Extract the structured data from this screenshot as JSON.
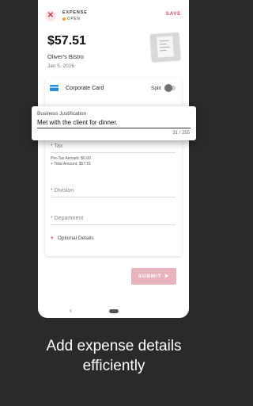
{
  "header": {
    "title": "EXPENSE",
    "status": "OPEN",
    "save_label": "SAVE",
    "close_icon": "close-icon",
    "status_dot_color": "#f2a12b"
  },
  "expense": {
    "amount": "$57.51",
    "merchant": "Oliver's Bistro",
    "date": "Jan 5, 2026"
  },
  "payment": {
    "method": "Corporate Card",
    "split_label": "Split",
    "split_enabled": false
  },
  "justification": {
    "label": "Business Justification",
    "value": "Met with the client for dinner.",
    "counter": "31 / 255"
  },
  "fields": {
    "tax_label": "* Tax",
    "pre_tax": "Pre-Tax Amount: $0.00",
    "total": "+ Total Amount: $57.51",
    "division_label": "* Division",
    "department_label": "* Department",
    "optional_plus": "+",
    "optional_label": "Optional Details"
  },
  "submit": {
    "label": "SUBMIT"
  },
  "nav": {
    "back": "‹"
  },
  "caption": {
    "line1": "Add expense details",
    "line2": "efficiently"
  },
  "colors": {
    "accent": "#c8344f",
    "submit_disabled": "#e7b3bc",
    "card_icon": "#2c8bd8",
    "background": "#2c2929"
  }
}
